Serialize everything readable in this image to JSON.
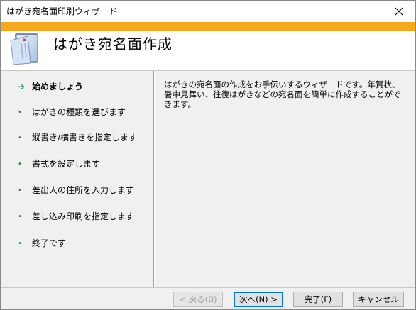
{
  "window": {
    "title": "はがき宛名面印刷ウィザード"
  },
  "header": {
    "heading": "はがき宛名面作成"
  },
  "steps": [
    {
      "label": "始めましょう",
      "current": true
    },
    {
      "label": "はがきの種類を選びます",
      "current": false
    },
    {
      "label": "縦書き/横書きを指定します",
      "current": false
    },
    {
      "label": "書式を設定します",
      "current": false
    },
    {
      "label": "差出人の住所を入力します",
      "current": false
    },
    {
      "label": "差し込み印刷を指定します",
      "current": false
    },
    {
      "label": "終了です",
      "current": false
    }
  ],
  "description": "はがきの宛名面の作成をお手伝いするウィザードです。年賀状、暑中見舞い、往復はがきなどの宛名面を簡単に作成することができます。",
  "buttons": {
    "back": "< 戻る(B)",
    "next": "次へ(N) >",
    "finish": "完了(F)",
    "cancel": "キャンセル"
  },
  "colors": {
    "accent": "#f5a81c",
    "bullet": "#1e8a3a",
    "panel": "#f0f0f0"
  }
}
